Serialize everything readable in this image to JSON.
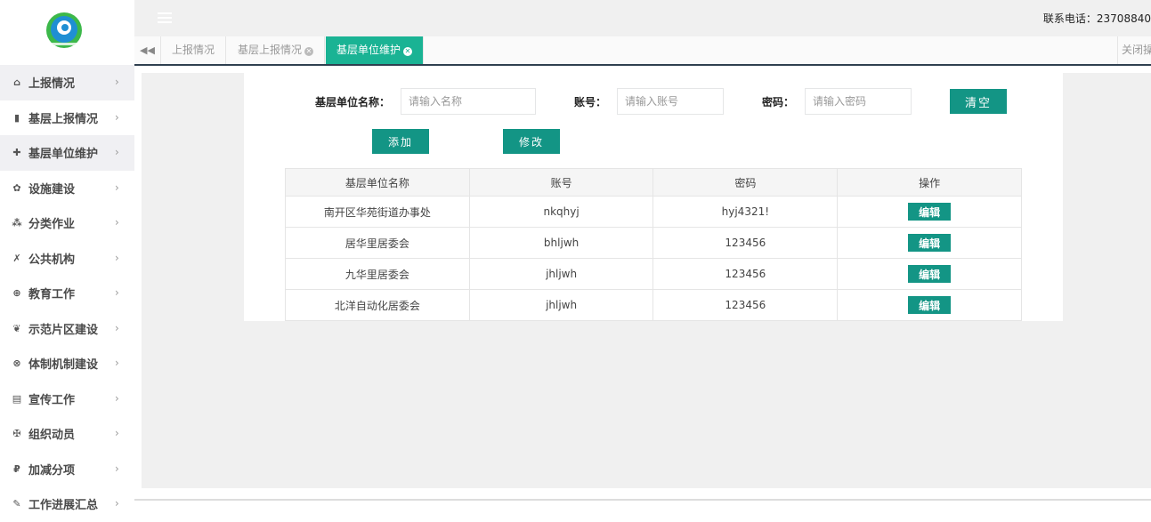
{
  "header": {
    "phone": "联系电话：23708840"
  },
  "sidebar": {
    "items": [
      {
        "icon": "home-icon",
        "glyph": "⌂",
        "label": "上报情况",
        "active": true
      },
      {
        "icon": "file-icon",
        "glyph": "▮",
        "label": "基层上报情况",
        "active": false
      },
      {
        "icon": "plus-icon",
        "glyph": "✚",
        "label": "基层单位维护",
        "active": true
      },
      {
        "icon": "cog-icon",
        "glyph": "✿",
        "label": "设施建设",
        "active": false
      },
      {
        "icon": "cubes-icon",
        "glyph": "⁂",
        "label": "分类作业",
        "active": false
      },
      {
        "icon": "flask-icon",
        "glyph": "✗",
        "label": "公共机构",
        "active": false
      },
      {
        "icon": "crosshair-icon",
        "glyph": "⊕",
        "label": "教育工作",
        "active": false
      },
      {
        "icon": "leaf-icon",
        "glyph": "❦",
        "label": "示范片区建设",
        "active": false
      },
      {
        "icon": "lifebuoy-icon",
        "glyph": "⊗",
        "label": "体制机制建设",
        "active": false
      },
      {
        "icon": "table-icon",
        "glyph": "▤",
        "label": "宣传工作",
        "active": false
      },
      {
        "icon": "users-icon",
        "glyph": "✠",
        "label": "组织动员",
        "active": false
      },
      {
        "icon": "ruble-icon",
        "glyph": "₽",
        "label": "加减分项",
        "active": false
      },
      {
        "icon": "edit-icon",
        "glyph": "✎",
        "label": "工作进展汇总",
        "active": false
      }
    ]
  },
  "tabs": [
    {
      "label": "上报情况",
      "closable": false,
      "active": false
    },
    {
      "label": "基层上报情况",
      "closable": true,
      "active": false
    },
    {
      "label": "基层单位维护",
      "closable": true,
      "active": true
    }
  ],
  "tabbar": {
    "close_ops": "关闭操作"
  },
  "form": {
    "name_label": "基层单位名称：",
    "name_placeholder": "请输入名称",
    "account_label": "账号：",
    "account_placeholder": "请输入账号",
    "password_label": "密码：",
    "password_placeholder": "请输入密码",
    "clear_label": "清空",
    "add_label": "添加",
    "modify_label": "修改"
  },
  "table": {
    "columns": [
      "基层单位名称",
      "账号",
      "密码",
      "操作"
    ],
    "edit_label": "编辑",
    "rows": [
      {
        "name": "南开区华苑街道办事处",
        "account": "nkqhyj",
        "password": "hyj4321!"
      },
      {
        "name": "居华里居委会",
        "account": "bhljwh",
        "password": "123456"
      },
      {
        "name": "九华里居委会",
        "account": "jhljwh",
        "password": "123456"
      },
      {
        "name": "北洋自动化居委会",
        "account": "jhljwh",
        "password": "123456"
      }
    ]
  },
  "colors": {
    "accent": "#139585",
    "tab_active": "#1ab394",
    "sidebar_active": "#f0f0f3"
  }
}
